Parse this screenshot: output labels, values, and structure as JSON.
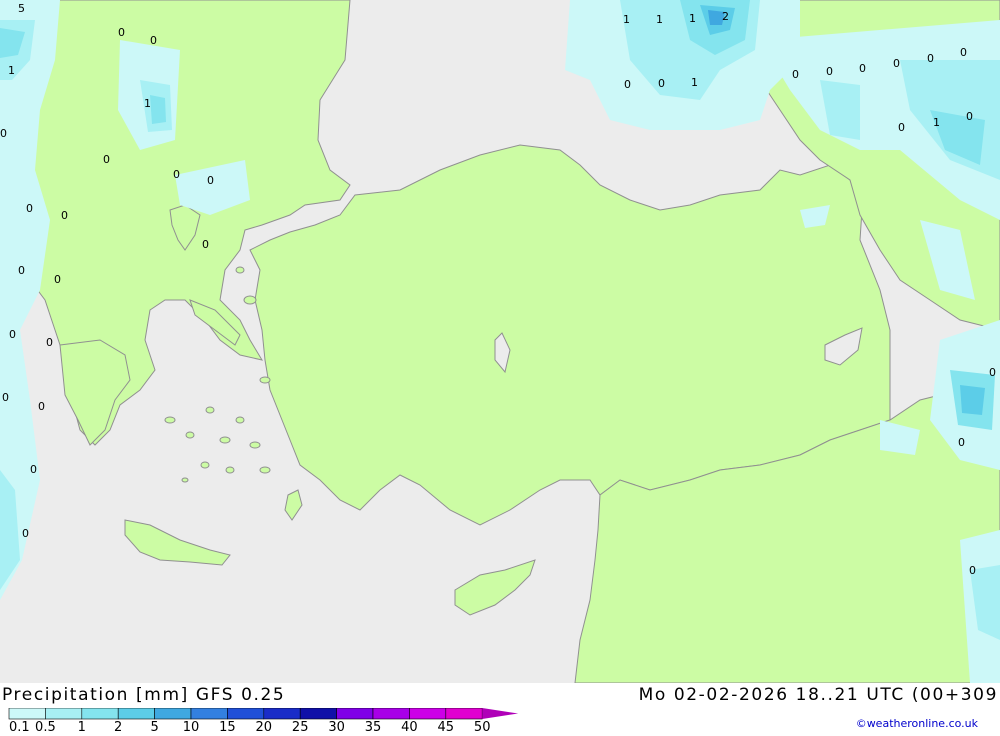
{
  "header": {
    "title": "Precipitation [mm]  GFS 0.25",
    "datetime": "Mo 02-02-2026 18..21 UTC (00+309"
  },
  "credit": "©weatheronline.co.uk",
  "legend": {
    "items": [
      {
        "label": "0.1",
        "color": "#ccf8f8"
      },
      {
        "label": "0.5",
        "color": "#a8f0f4"
      },
      {
        "label": "1",
        "color": "#84e4ee"
      },
      {
        "label": "2",
        "color": "#5ccde8"
      },
      {
        "label": "5",
        "color": "#3fa8e0"
      },
      {
        "label": "10",
        "color": "#3380e0"
      },
      {
        "label": "15",
        "color": "#2050d8"
      },
      {
        "label": "20",
        "color": "#1a2cc8"
      },
      {
        "label": "25",
        "color": "#1010a8"
      },
      {
        "label": "30",
        "color": "#8000e8"
      },
      {
        "label": "35",
        "color": "#a800e8"
      },
      {
        "label": "40",
        "color": "#cc00e8"
      },
      {
        "label": "45",
        "color": "#e000d0"
      },
      {
        "label": "50",
        "color": "#b000b8"
      }
    ]
  },
  "colors": {
    "land": "#ccfca4",
    "sea": "#ececec",
    "border": "#909090"
  },
  "labels": [
    "5",
    "0",
    "0",
    "1",
    "1",
    "0",
    "0",
    "0",
    "0",
    "0",
    "0",
    "0",
    "0",
    "0",
    "0",
    "0",
    "0",
    "0",
    "0",
    "0",
    "1",
    "1",
    "1",
    "2",
    "0",
    "0",
    "1",
    "0",
    "0",
    "0",
    "0",
    "0",
    "0",
    "0",
    "1",
    "0",
    "0",
    "0",
    "0"
  ]
}
